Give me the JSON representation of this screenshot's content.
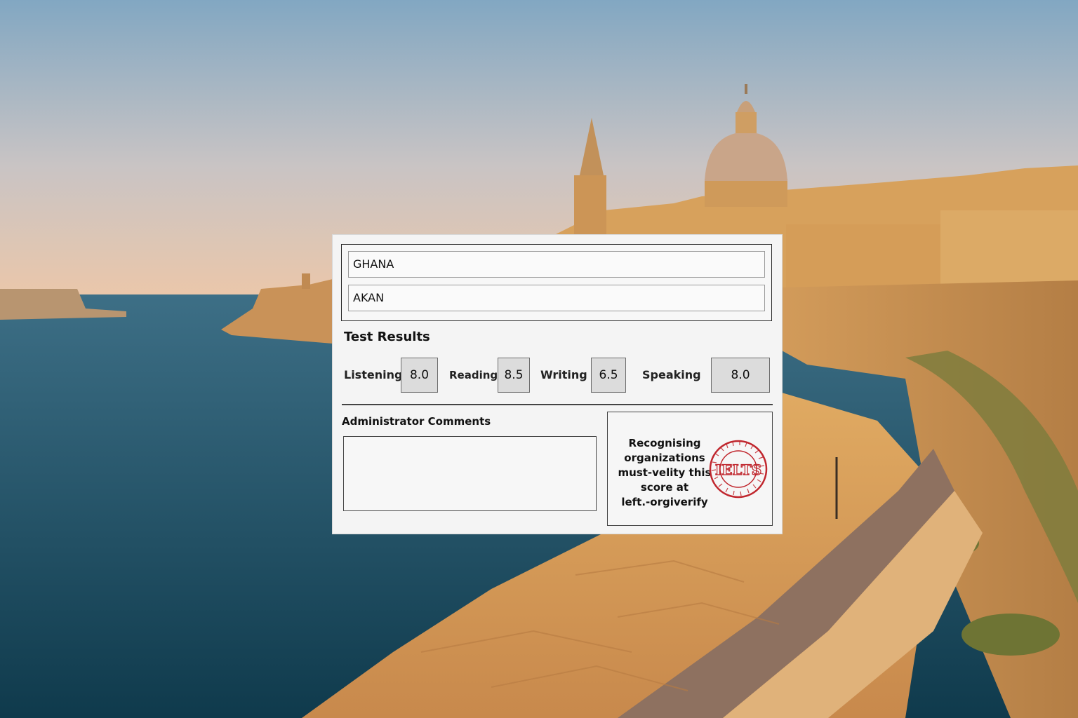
{
  "candidate": {
    "nationality": "GHANA",
    "first_language": "AKAN"
  },
  "test_results": {
    "title": "Test Results",
    "scores": [
      {
        "label": "Listening",
        "value": "8.0"
      },
      {
        "label": "Reading",
        "value": "8.5"
      },
      {
        "label": "Writing",
        "value": "6.5"
      },
      {
        "label": "Speaking",
        "value": "8.0"
      }
    ]
  },
  "admin": {
    "title": "Administrator Comments"
  },
  "verification": {
    "line1": "Recognising",
    "line2": "organizations",
    "line3": "must-velity this",
    "line4": "score at",
    "line5": "left.-orgiverify",
    "stamp_text": "IELTS",
    "stamp_color": "#c0262d"
  },
  "colors": {
    "sky_top": "#86a8c2",
    "sky_bottom": "#e9c3a6",
    "sea": "#1f5066",
    "stone": "#d59a55"
  }
}
